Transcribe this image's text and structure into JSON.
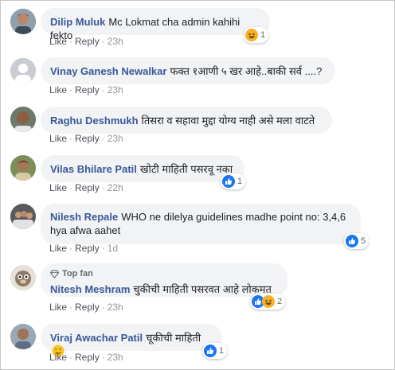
{
  "actions": {
    "like": "Like",
    "reply": "Reply",
    "dot": "·"
  },
  "top_fan_label": "Top fan",
  "comments": [
    {
      "author": "Dilip Muluk",
      "text": "Mc Lokmat cha admin kahihi fekto",
      "time": "23h",
      "reaction_count": "1",
      "reactions": [
        "haha-icon"
      ]
    },
    {
      "author": "Vinay Ganesh Newalkar",
      "text": "फक्त १आणी ५ खर आहे..बाकी सर्व ....?",
      "time": "23h"
    },
    {
      "author": "Raghu Deshmukh",
      "text": "तिसरा व सहावा मुद्दा योग्य नाही असे मला वाटते",
      "time": "23h"
    },
    {
      "author": "Vilas Bhilare Patil",
      "text": "खोटी माहिती पसरवू नका",
      "time": "22h",
      "reaction_count": "1",
      "reactions": [
        "like-icon"
      ]
    },
    {
      "author": "Nilesh Repale",
      "text": "WHO ne dilelya guidelines madhe point no: 3,4,6 hya afwa aahet",
      "time": "1d",
      "reaction_count": "5",
      "reactions": [
        "like-icon"
      ]
    },
    {
      "author": "Nitesh Meshram",
      "text": "चुकीची माहिती पसरवत आहे लोकमत",
      "time": "23h",
      "reaction_count": "2",
      "reactions": [
        "like-icon",
        "haha-icon"
      ],
      "top_fan": true
    },
    {
      "author": "Viraj Awachar Patil",
      "text": "चूकीची माहिती",
      "time": "23h",
      "reaction_count": "1",
      "reactions": [
        "like-icon"
      ]
    }
  ],
  "colors": {
    "author": "#385898",
    "bubble": "#f2f3f5",
    "like_blue": "#1877f2",
    "haha_yellow": "#f7b125"
  }
}
